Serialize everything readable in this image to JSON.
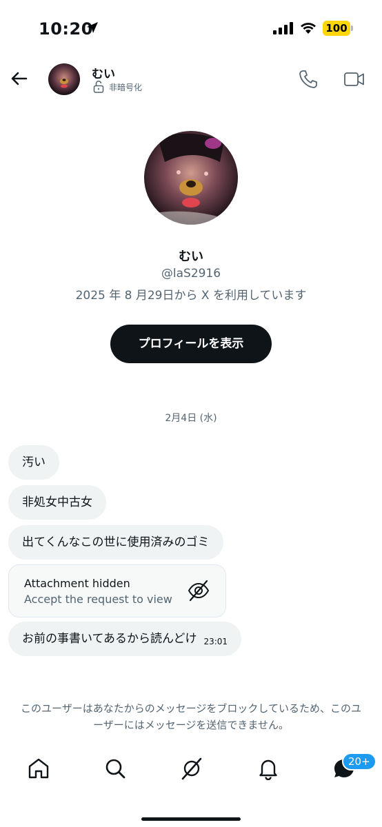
{
  "status_bar": {
    "time": "10:20",
    "battery": "100"
  },
  "header": {
    "name": "むい",
    "encryption_status": "非暗号化"
  },
  "profile": {
    "name": "むい",
    "handle": "@laS2916",
    "joined": "2025 年 8 月29日から X を利用しています",
    "view_profile_label": "プロフィールを表示"
  },
  "conversation": {
    "date": "2月4日 (水)",
    "messages": [
      {
        "text": "汚い"
      },
      {
        "text": "非処女中古女"
      },
      {
        "text": "出てくんなこの世に使用済みのゴミ"
      },
      {
        "text": "お前の事書いてあるから読んどけ",
        "time": "23:01"
      }
    ],
    "attachment": {
      "title": "Attachment hidden",
      "subtitle": "Accept the request to view"
    },
    "blocked_notice": "このユーザーはあなたからのメッセージをブロックしているため、このユーザーにはメッセージを送信できません。"
  },
  "bottom_nav": {
    "messages_badge": "20+"
  },
  "colors": {
    "accent": "#1d9bf0",
    "text": "#0f1419",
    "muted": "#536471",
    "bubble": "#eff3f4",
    "battery": "#ffd60a"
  }
}
